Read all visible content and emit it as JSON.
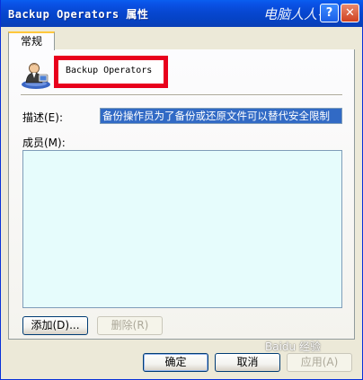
{
  "window": {
    "title": "Backup Operators 属性",
    "watermark": "电脑人人有",
    "help_label": "?",
    "close_label": "✕"
  },
  "tabs": [
    {
      "label": "常规",
      "selected": true
    }
  ],
  "general": {
    "group_name": "Backup Operators",
    "icon": "user-group-icon",
    "description_label": "描述(E):",
    "description_value": "备份操作员为了备份或还原文件可以替代安全限制",
    "members_label": "成员(M):",
    "members": [],
    "add_button": "添加(D)...",
    "remove_button": "删除(R)",
    "remove_enabled": false
  },
  "footer": {
    "ok_button": "确定",
    "cancel_button": "取消",
    "apply_button": "应用(A)",
    "apply_enabled": false
  },
  "overlay": {
    "watermark_bottom": "Baidu 经验",
    "highlight_color": "#e8001c"
  }
}
